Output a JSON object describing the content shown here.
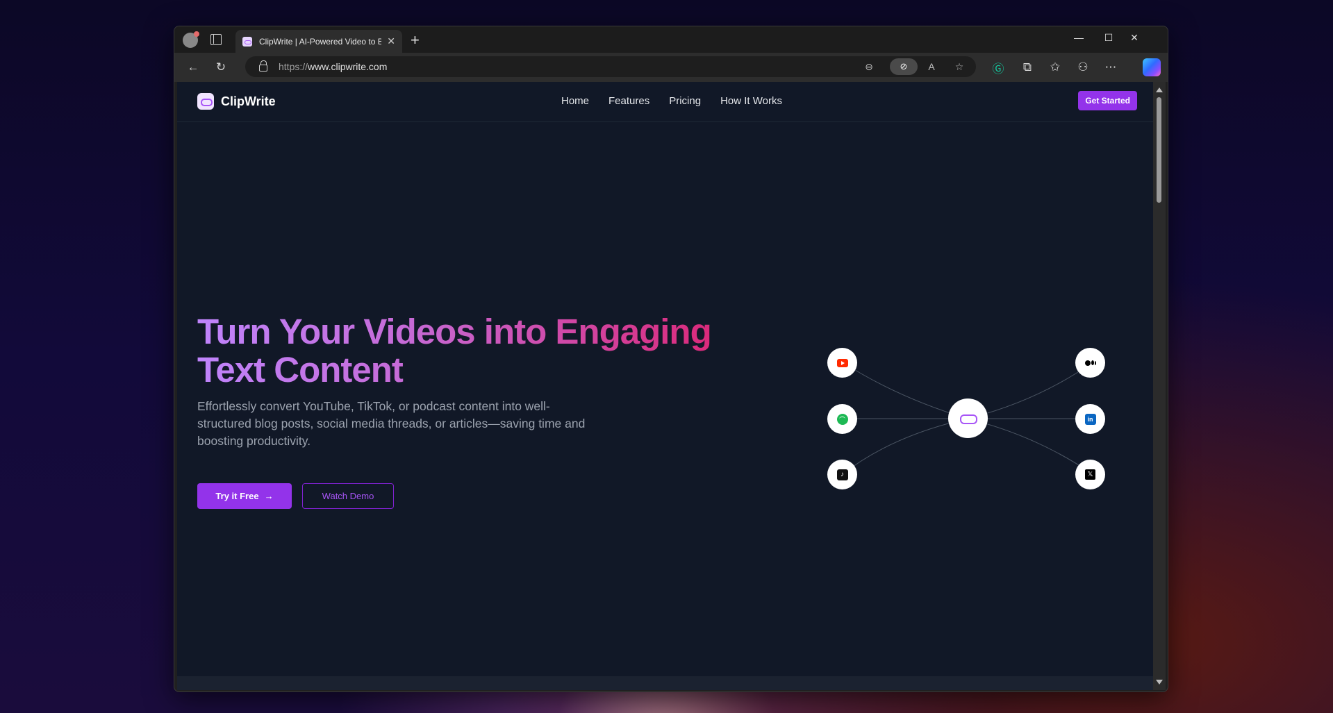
{
  "browser": {
    "tab_title": "ClipWrite | AI-Powered Video to B",
    "tab_close": "✕",
    "new_tab": "+",
    "url_protocol": "https://",
    "url_host": "www.clipwrite.com",
    "window_controls": {
      "minimize": "—",
      "maximize": "☐",
      "close": "✕"
    },
    "toolbar_icons": [
      "back-icon",
      "refresh-icon",
      "zoom-out-icon",
      "tracking-prevention-icon",
      "read-aloud-icon",
      "favorite-icon",
      "grammarly-icon",
      "extensions-icon",
      "favorites-icon",
      "collections-icon",
      "more-icon",
      "copilot-icon"
    ]
  },
  "site": {
    "logo_text": "ClipWrite",
    "nav": [
      "Home",
      "Features",
      "Pricing",
      "How It Works"
    ],
    "cta": "Get Started"
  },
  "hero": {
    "title_line1": "Turn Your Videos into Engaging",
    "title_line2": "Text Content",
    "subtitle": "Effortlessly convert YouTube, TikTok, or podcast content into well-structured blog posts, social media threads, or articles—saving time and boosting productivity.",
    "primary_button": "Try it Free",
    "secondary_button": "Watch Demo"
  },
  "diagram": {
    "inputs": [
      "youtube-icon",
      "spotify-icon",
      "tiktok-icon"
    ],
    "outputs": [
      "medium-icon",
      "linkedin-icon",
      "x-icon"
    ],
    "hub": "clipwrite-logo-icon",
    "linkedin_label": "in",
    "x_label": "𝕏",
    "tiktok_label": "♪"
  },
  "colors": {
    "accent": "#9333ea",
    "background": "#111827",
    "gradient_start": "#c084fc",
    "gradient_end": "#db2777"
  }
}
